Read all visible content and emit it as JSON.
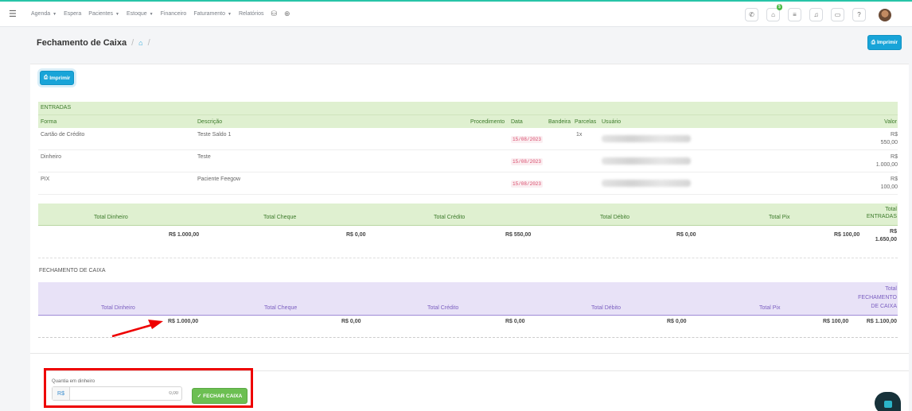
{
  "nav": {
    "items": [
      {
        "label": "Agenda",
        "caret": true
      },
      {
        "label": "Espera",
        "caret": false
      },
      {
        "label": "Pacientes",
        "caret": true
      },
      {
        "label": "Estoque",
        "caret": true
      },
      {
        "label": "Financeiro",
        "caret": false
      },
      {
        "label": "Faturamento",
        "caret": true
      },
      {
        "label": "Relatórios",
        "caret": false
      }
    ],
    "notif_badge": "$"
  },
  "header": {
    "title": "Fechamento de Caixa",
    "print_label": "Imprimir"
  },
  "card": {
    "print_label": "Imprimir"
  },
  "entries": {
    "title": "ENTRADAS",
    "columns": [
      "Forma",
      "Descrição",
      "Procedimento",
      "Data",
      "Bandeira",
      "Parcelas",
      "Usuário",
      "Valor"
    ],
    "rows": [
      {
        "forma": "Cartão de Crédito",
        "descricao": "Teste Saldo 1",
        "data": "15/08/2023",
        "parcelas": "1x",
        "valor_cur": "R$",
        "valor": "550,00"
      },
      {
        "forma": "Dinheiro",
        "descricao": "Teste",
        "data": "15/08/2023",
        "parcelas": "",
        "valor_cur": "R$",
        "valor": "1.000,00"
      },
      {
        "forma": "PIX",
        "descricao": "Paciente Feegow",
        "data": "15/08/2023",
        "parcelas": "",
        "valor_cur": "R$",
        "valor": "100,00"
      }
    ],
    "totals_headers": [
      "Total Dinheiro",
      "Total Cheque",
      "Total Crédito",
      "Total Débito",
      "Total Pix"
    ],
    "totals_last_header": [
      "Total",
      "ENTRADAS"
    ],
    "totals_values": [
      "R$ 1.000,00",
      "R$ 0,00",
      "R$ 550,00",
      "R$ 0,00",
      "R$ 100,00"
    ],
    "total_entradas": [
      "R$",
      "1.650,00"
    ]
  },
  "fechamento": {
    "label": "FECHAMENTO DE CAIXA",
    "headers": [
      "Total Dinheiro",
      "Total Cheque",
      "Total Crédito",
      "Total Débito",
      "Total Pix"
    ],
    "last_header": [
      "Total",
      "FECHAMENTO",
      "DE CAIXA"
    ],
    "values": [
      "R$ 1.000,00",
      "R$ 0,00",
      "R$ 0,00",
      "R$ 0,00",
      "R$ 100,00"
    ],
    "total": "R$ 1.100,00"
  },
  "cash": {
    "label": "Quantia em dinheiro",
    "prefix": "R$",
    "placeholder": "0,00",
    "button": "FECHAR CAIXA"
  },
  "colors": {
    "accent": "#18a4d8",
    "green_header": "#dff0d0",
    "purple_header": "#e8e2f7",
    "success": "#6cbf52",
    "annotation": "#ee0000"
  }
}
